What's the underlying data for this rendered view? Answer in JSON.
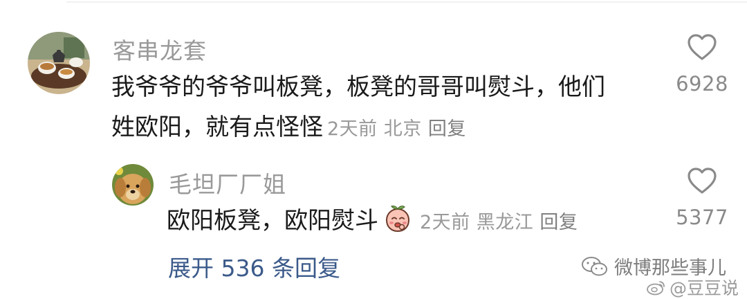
{
  "comment": {
    "username": "客串龙套",
    "text_line1": "我爷爷的爷爷叫板凳，板凳的哥哥叫熨斗，他们",
    "text_line2": "姓欧阳，就有点怪怪",
    "time": "2天前",
    "location": "北京",
    "reply_label": "回复",
    "likes": "6928"
  },
  "reply": {
    "username": "毛坦厂厂姐",
    "text": "欧阳板凳，欧阳熨斗",
    "time": "2天前",
    "location": "黑龙江",
    "reply_label": "回复",
    "likes": "5377",
    "emoji": "peach-face-emoji"
  },
  "expand_label": "展开 536 条回复",
  "watermark": {
    "line1": "微博那些事儿",
    "line2": "@豆豆说"
  },
  "colors": {
    "username": "#999999",
    "text": "#1a1a1a",
    "meta": "#999999",
    "link": "#3b5a8a",
    "like_icon": "#8a8a8a"
  }
}
